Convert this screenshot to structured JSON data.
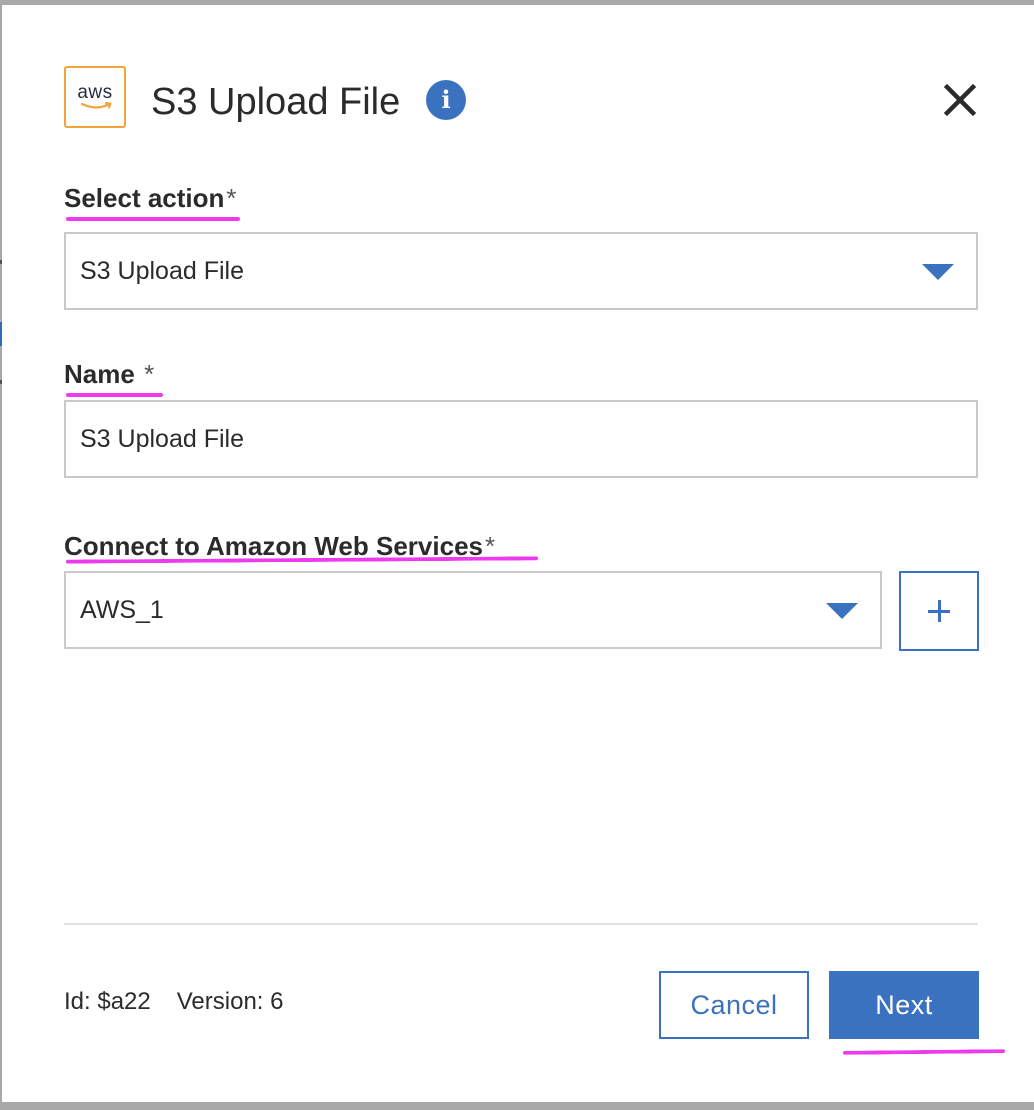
{
  "dialog": {
    "logo_text": "aws",
    "title": "S3 Upload File",
    "info_icon": "info-icon",
    "close_icon": "close-icon"
  },
  "fields": {
    "action": {
      "label": "Select action",
      "required_mark": "*",
      "value": "S3 Upload File"
    },
    "name": {
      "label": "Name",
      "required_mark": "*",
      "value": "S3 Upload File"
    },
    "connection": {
      "label": "Connect to Amazon Web Services",
      "required_mark": "*",
      "value": "AWS_1",
      "add_icon": "plus-icon"
    }
  },
  "footer": {
    "id_text": "Id: $a22",
    "version_text": "Version: 6",
    "cancel_label": "Cancel",
    "next_label": "Next"
  },
  "colors": {
    "accent": "#3b72c0",
    "aws_orange": "#f2a33a",
    "annotation_magenta": "#ee3aee",
    "border": "#c9c9c9"
  }
}
